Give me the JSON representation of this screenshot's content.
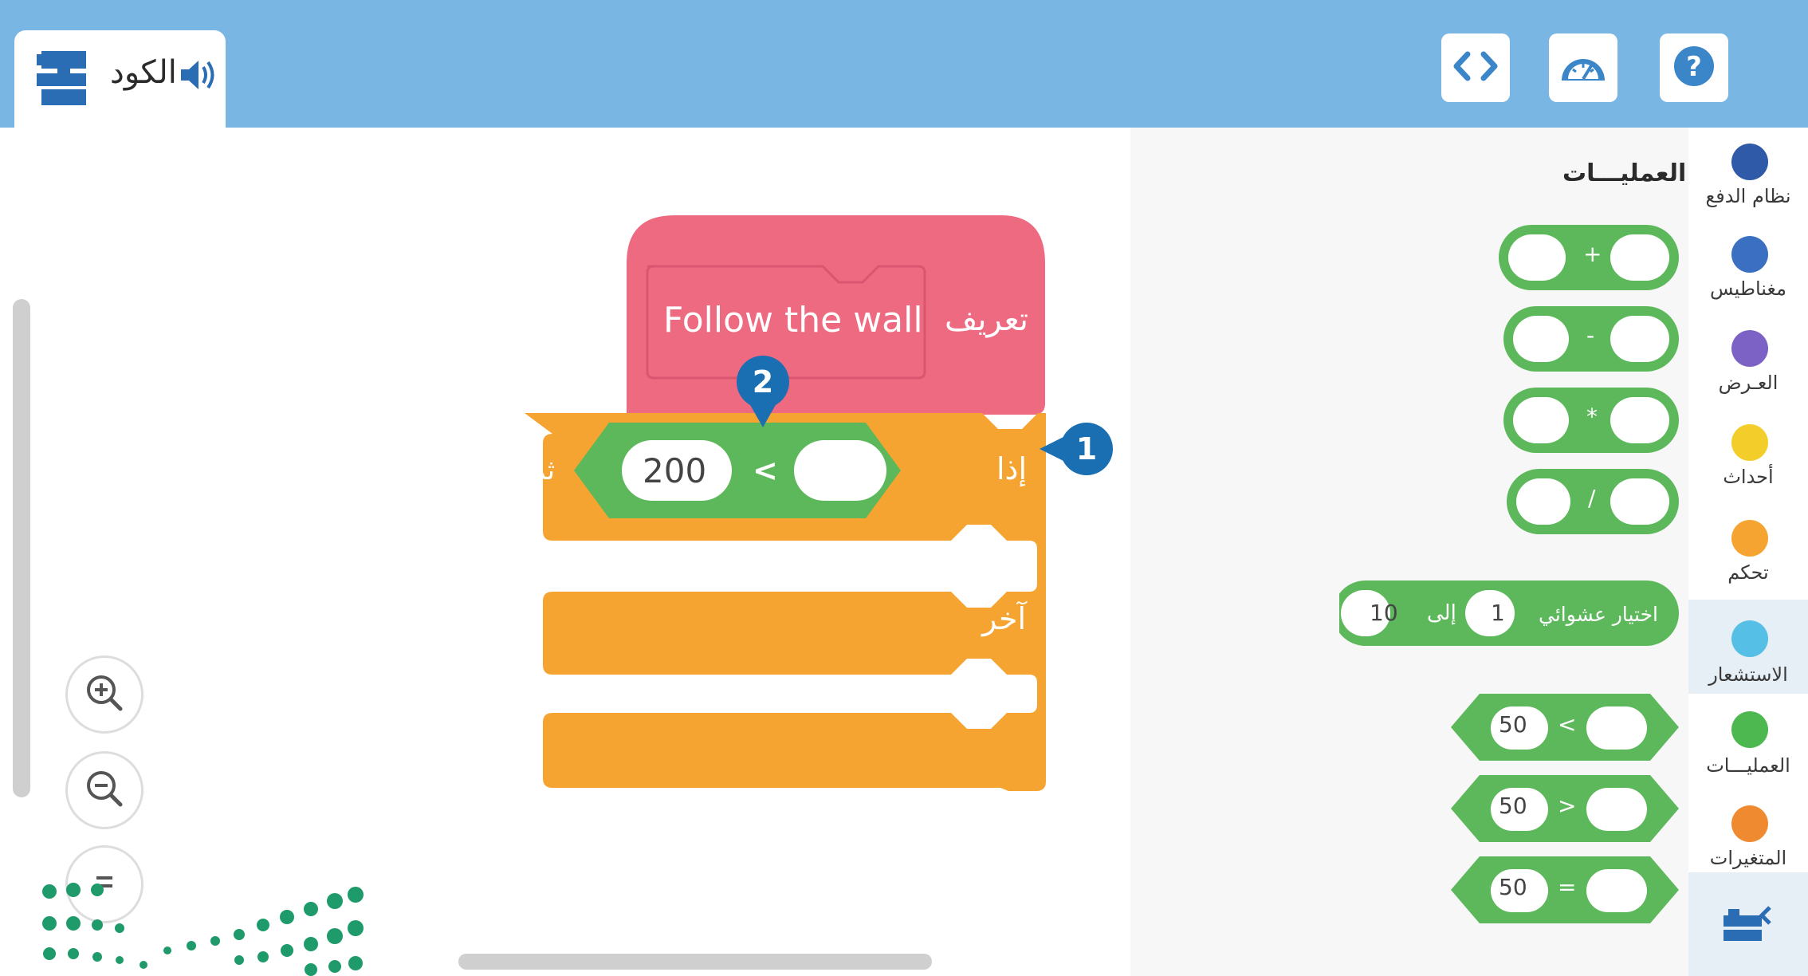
{
  "toolbar": {
    "code_tab_label": "الكود"
  },
  "workspace": {
    "define_label": "تعريف",
    "procedure_name": "Follow the wall",
    "if_label": "إذا",
    "then_label": "ثم",
    "else_label": "آخر",
    "compare_value": "200",
    "compare_operator": "<"
  },
  "callouts": {
    "first": "1",
    "second": "2"
  },
  "palette": {
    "section_title": "العمليـــات",
    "add_op": "+",
    "sub_op": "-",
    "mul_op": "*",
    "div_op": "/",
    "random_label": "اختيار عشوائي",
    "random_from": "1",
    "random_to_label": "إلى",
    "random_to": "10",
    "lt_value": "50",
    "lt_op": "<",
    "gt_value": "50",
    "gt_op": ">",
    "eq_value": "50",
    "eq_op": "="
  },
  "categories": [
    {
      "label": "نظام الدفع",
      "color": "#2e5aa8"
    },
    {
      "label": "مغناطيس",
      "color": "#3a6fc1"
    },
    {
      "label": "العـرض",
      "color": "#7b62c4"
    },
    {
      "label": "أحداث",
      "color": "#f3cd2a"
    },
    {
      "label": "تحكم",
      "color": "#f5a331"
    },
    {
      "label": "الاستشعار",
      "color": "#56bfe6"
    },
    {
      "label": "العمليـــات",
      "color": "#4cb84f"
    },
    {
      "label": "المتغيرات",
      "color": "#f08a30"
    }
  ],
  "colors": {
    "topbar": "#79b6e3",
    "define_block": "#ee6a80",
    "control_block": "#f5a431",
    "operator_block": "#5cb85a",
    "callout": "#1a6fb2"
  }
}
